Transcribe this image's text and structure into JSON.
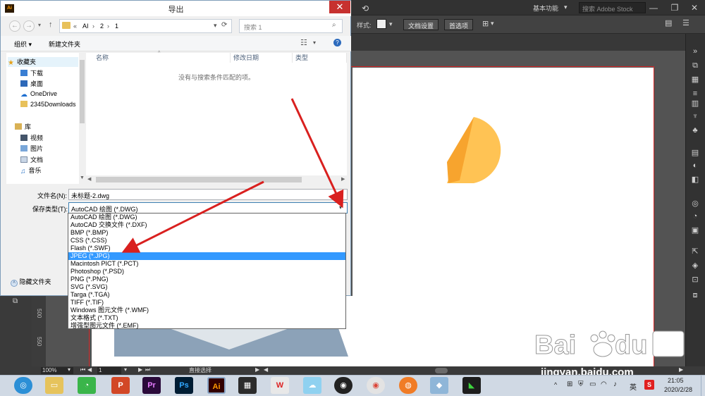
{
  "dialog": {
    "title": "导出",
    "app_icon": "Ai",
    "address": {
      "sep": "«",
      "parts": [
        "AI",
        "2",
        "1"
      ]
    },
    "search_placeholder": "搜索 1",
    "toolbar": {
      "organize": "组织 ▾",
      "new_folder": "新建文件夹"
    },
    "nav": {
      "favorites": "收藏夹",
      "items": [
        "下载",
        "桌面",
        "OneDrive",
        "2345Downloads"
      ],
      "library": "库",
      "lib_items": [
        "视频",
        "图片",
        "文档",
        "音乐"
      ]
    },
    "columns": [
      "名称",
      "修改日期",
      "类型"
    ],
    "empty_message": "没有与搜索条件匹配的项。",
    "filename_label": "文件名(N):",
    "filename_value": "未标题-2.dwg",
    "savetype_label": "保存类型(T):",
    "savetype_value": "AutoCAD 绘图 (*.DWG)",
    "options": [
      "AutoCAD 绘图 (*.DWG)",
      "AutoCAD 交换文件 (*.DXF)",
      "BMP (*.BMP)",
      "CSS (*.CSS)",
      "Flash (*.SWF)",
      "JPEG (*.JPG)",
      "Macintosh PICT (*.PCT)",
      "Photoshop (*.PSD)",
      "PNG (*.PNG)",
      "SVG (*.SVG)",
      "Targa (*.TGA)",
      "TIFF (*.TIF)",
      "Windows 图元文件 (*.WMF)",
      "文本格式 (*.TXT)",
      "增强型图元文件 (*.EMF)"
    ],
    "selected_option_index": 5,
    "hide_folders": "隐藏文件夹"
  },
  "illustrator": {
    "workspace": "基本功能",
    "stock_search": "搜索 Adobe Stock",
    "style_label": "样式:",
    "doc_setup": "文档设置",
    "preferences": "首选项",
    "zoom": "100%",
    "artboard_num": "1",
    "status_tool": "直接选择",
    "ruler_labels": [
      "500",
      "550"
    ]
  },
  "taskbar": {
    "apps": [
      "Pr",
      "Ps",
      "Ai"
    ],
    "ime": "英",
    "time": "21:05",
    "date": "2020/2/28"
  },
  "watermark": {
    "url": "jingyan.baidu.com"
  },
  "colors": {
    "shape_light": "#ffc354",
    "shape_dark": "#f7a42e",
    "arrow": "#d9201f",
    "selection": "#3399ff",
    "shape_bottom": "#8ca2b8"
  }
}
